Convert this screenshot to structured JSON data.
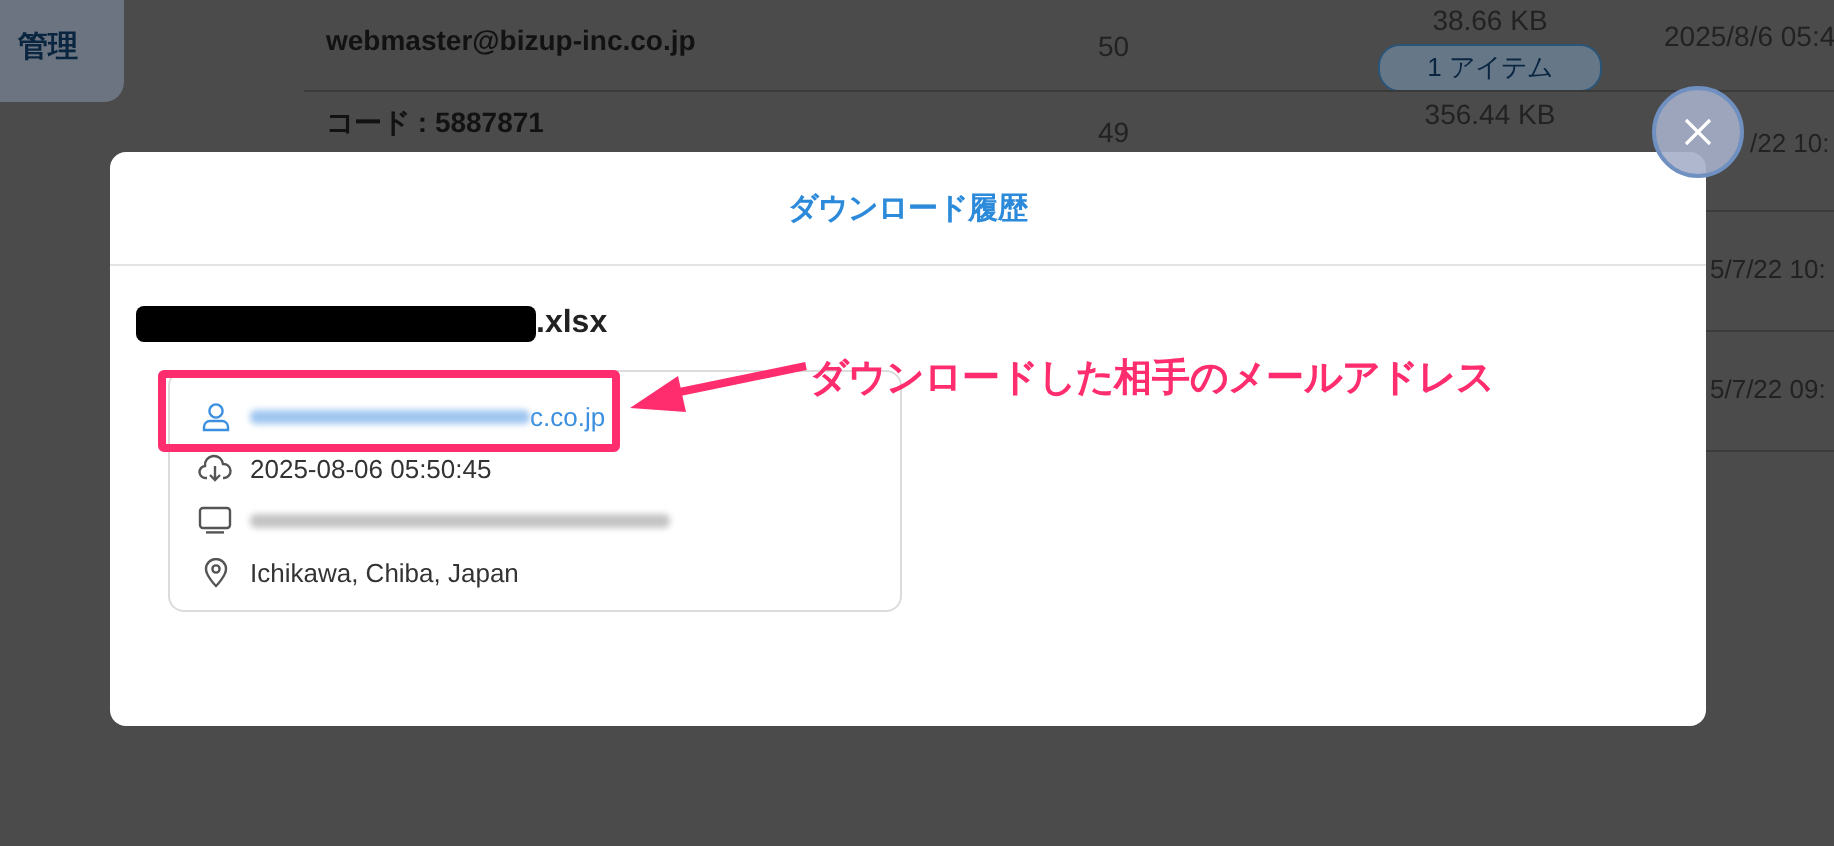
{
  "background": {
    "sidebar_item": "管理",
    "rows": [
      {
        "name": "webmaster@bizup-inc.co.jp",
        "count": "50",
        "size": "38.66 KB",
        "badge": "1 アイテム",
        "date": "2025/8/6 05:4"
      },
      {
        "name": "コード : 5887871",
        "count": "49",
        "size": "356.44 KB",
        "date": "/22 10:"
      },
      {
        "date": "5/7/22 10:"
      },
      {
        "date": "5/7/22 09:"
      }
    ]
  },
  "modal": {
    "title": "ダウンロード履歴",
    "file_suffix": ".xlsx",
    "details": [
      {
        "kind": "user",
        "text": "c.co.jp",
        "blurred": true
      },
      {
        "kind": "download",
        "text": "2025-08-06 05:50:45"
      },
      {
        "kind": "device",
        "blurred": true
      },
      {
        "kind": "location",
        "text": "Ichikawa, Chiba, Japan"
      }
    ],
    "annotation": "ダウンロードした相手のメールアドレス"
  }
}
